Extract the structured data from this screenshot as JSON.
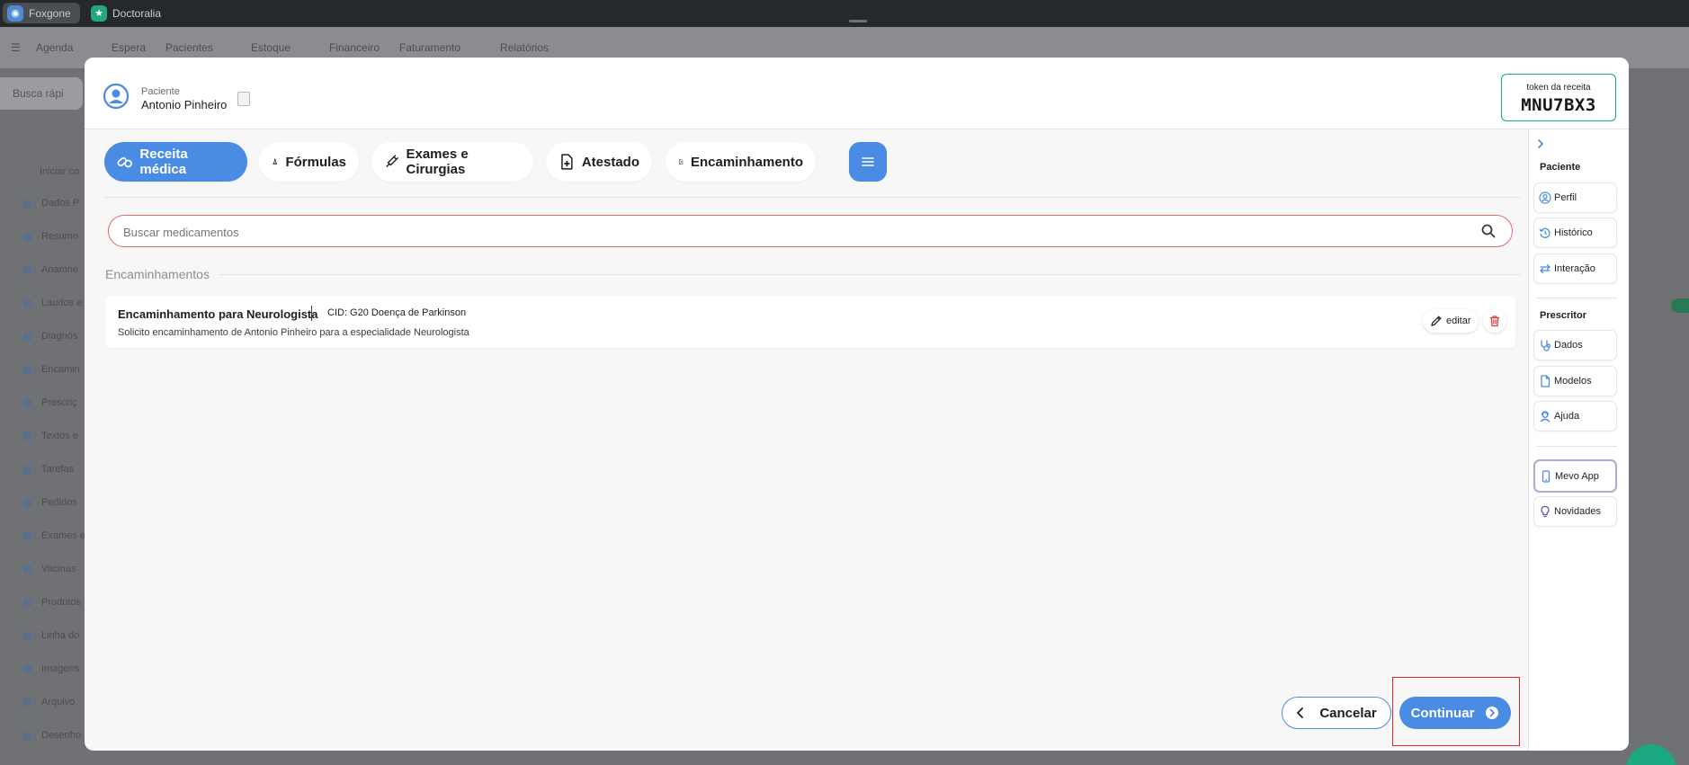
{
  "browser": {
    "tabs": [
      {
        "label": "Foxgone",
        "icon": "app-icon"
      },
      {
        "label": "Doctoralia",
        "icon": "doctoralia-icon"
      }
    ]
  },
  "app_nav": {
    "items": [
      "Agenda",
      "Espera",
      "Pacientes",
      "Estoque",
      "Financeiro",
      "Faturamento",
      "Relatórios"
    ]
  },
  "app_sidebar": {
    "search_placeholder": "Busca rápi",
    "items": [
      "Iniciar co",
      "Dados P",
      "Resumo",
      "Anamne",
      "Laudos e",
      "Diagnós",
      "Encamin",
      "Prescriç",
      "Textos e",
      "Tarefas",
      "Pedidos",
      "Exames e",
      "Vacinas",
      "Produtos",
      "Linha do",
      "Imagens",
      "Arquivo",
      "Desenho"
    ]
  },
  "modal": {
    "patient": {
      "label": "Paciente",
      "name": "Antonio Pinheiro"
    },
    "token": {
      "label": "token da receita",
      "value": "MNU7BX3",
      "color": "#14a987"
    },
    "tabs": [
      {
        "label": "Receita médica",
        "icon": "pills-icon",
        "active": true
      },
      {
        "label": "Fórmulas",
        "icon": "flask-icon",
        "active": false
      },
      {
        "label": "Exames e Cirurgias",
        "icon": "syringe-icon",
        "active": false
      },
      {
        "label": "Atestado",
        "icon": "medical-document-icon",
        "active": false
      },
      {
        "label": "Encaminhamento",
        "icon": "referral-document-icon",
        "active": false
      }
    ],
    "search": {
      "placeholder": "Buscar medicamentos",
      "value": ""
    },
    "section_title": "Encaminhamentos",
    "referral": {
      "title": "Encaminhamento para Neurologista",
      "cid": "CID: G20 Doença de Parkinson",
      "description": "Solicito encaminhamento de Antonio Pinheiro para a especialidade Neurologista",
      "edit_label": "editar"
    },
    "footer": {
      "cancel_label": "Cancelar",
      "continue_label": "Continuar"
    },
    "accent_color": "#4a8be3",
    "right_sidebar": {
      "patient_group": "Paciente",
      "patient_items": [
        {
          "label": "Perfil",
          "icon": "profile-icon"
        },
        {
          "label": "Histórico",
          "icon": "history-icon"
        },
        {
          "label": "Interação",
          "icon": "interaction-icon"
        }
      ],
      "prescriber_group": "Prescritor",
      "prescriber_items": [
        {
          "label": "Dados",
          "icon": "stethoscope-icon"
        },
        {
          "label": "Modelos",
          "icon": "document-icon"
        },
        {
          "label": "Ajuda",
          "icon": "support-icon"
        }
      ],
      "extra_items": [
        {
          "label": "Mevo App",
          "icon": "phone-icon"
        },
        {
          "label": "Novidades",
          "icon": "lightbulb-icon"
        }
      ]
    }
  }
}
